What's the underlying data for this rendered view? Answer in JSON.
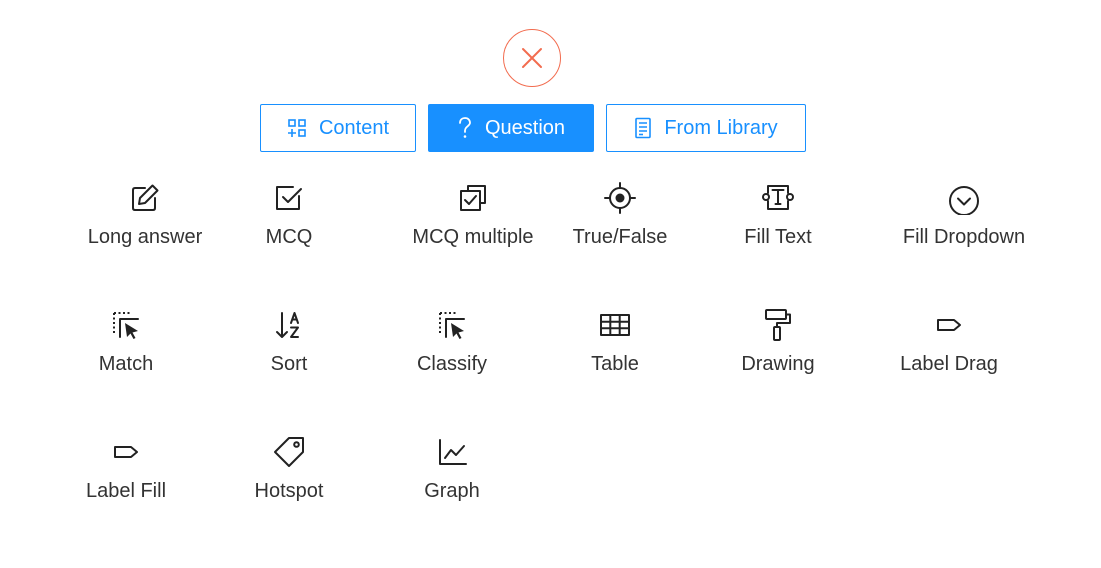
{
  "close": {
    "icon": "close-icon",
    "color": "#f26c4f"
  },
  "tabs": [
    {
      "label": "Content",
      "icon": "content-blocks-icon",
      "active": false
    },
    {
      "label": "Question",
      "icon": "question-mark-icon",
      "active": true
    },
    {
      "label": "From Library",
      "icon": "library-icon",
      "active": false
    }
  ],
  "accent_color": "#1890ff",
  "question_types": [
    {
      "label": "Long answer",
      "icon": "edit-icon"
    },
    {
      "label": "MCQ",
      "icon": "checkbox-icon"
    },
    {
      "label": "MCQ multiple",
      "icon": "multi-checkbox-icon"
    },
    {
      "label": "True/False",
      "icon": "target-icon"
    },
    {
      "label": "Fill Text",
      "icon": "text-field-icon"
    },
    {
      "label": "Fill Dropdown",
      "icon": "chevron-circle-icon"
    },
    {
      "label": "Match",
      "icon": "select-pointer-icon"
    },
    {
      "label": "Sort",
      "icon": "sort-alpha-icon"
    },
    {
      "label": "Classify",
      "icon": "select-pointer-icon"
    },
    {
      "label": "Table",
      "icon": "table-icon"
    },
    {
      "label": "Drawing",
      "icon": "paint-roller-icon"
    },
    {
      "label": "Label Drag",
      "icon": "label-icon"
    },
    {
      "label": "Label Fill",
      "icon": "label-icon"
    },
    {
      "label": "Hotspot",
      "icon": "tag-icon"
    },
    {
      "label": "Graph",
      "icon": "line-chart-icon"
    }
  ]
}
